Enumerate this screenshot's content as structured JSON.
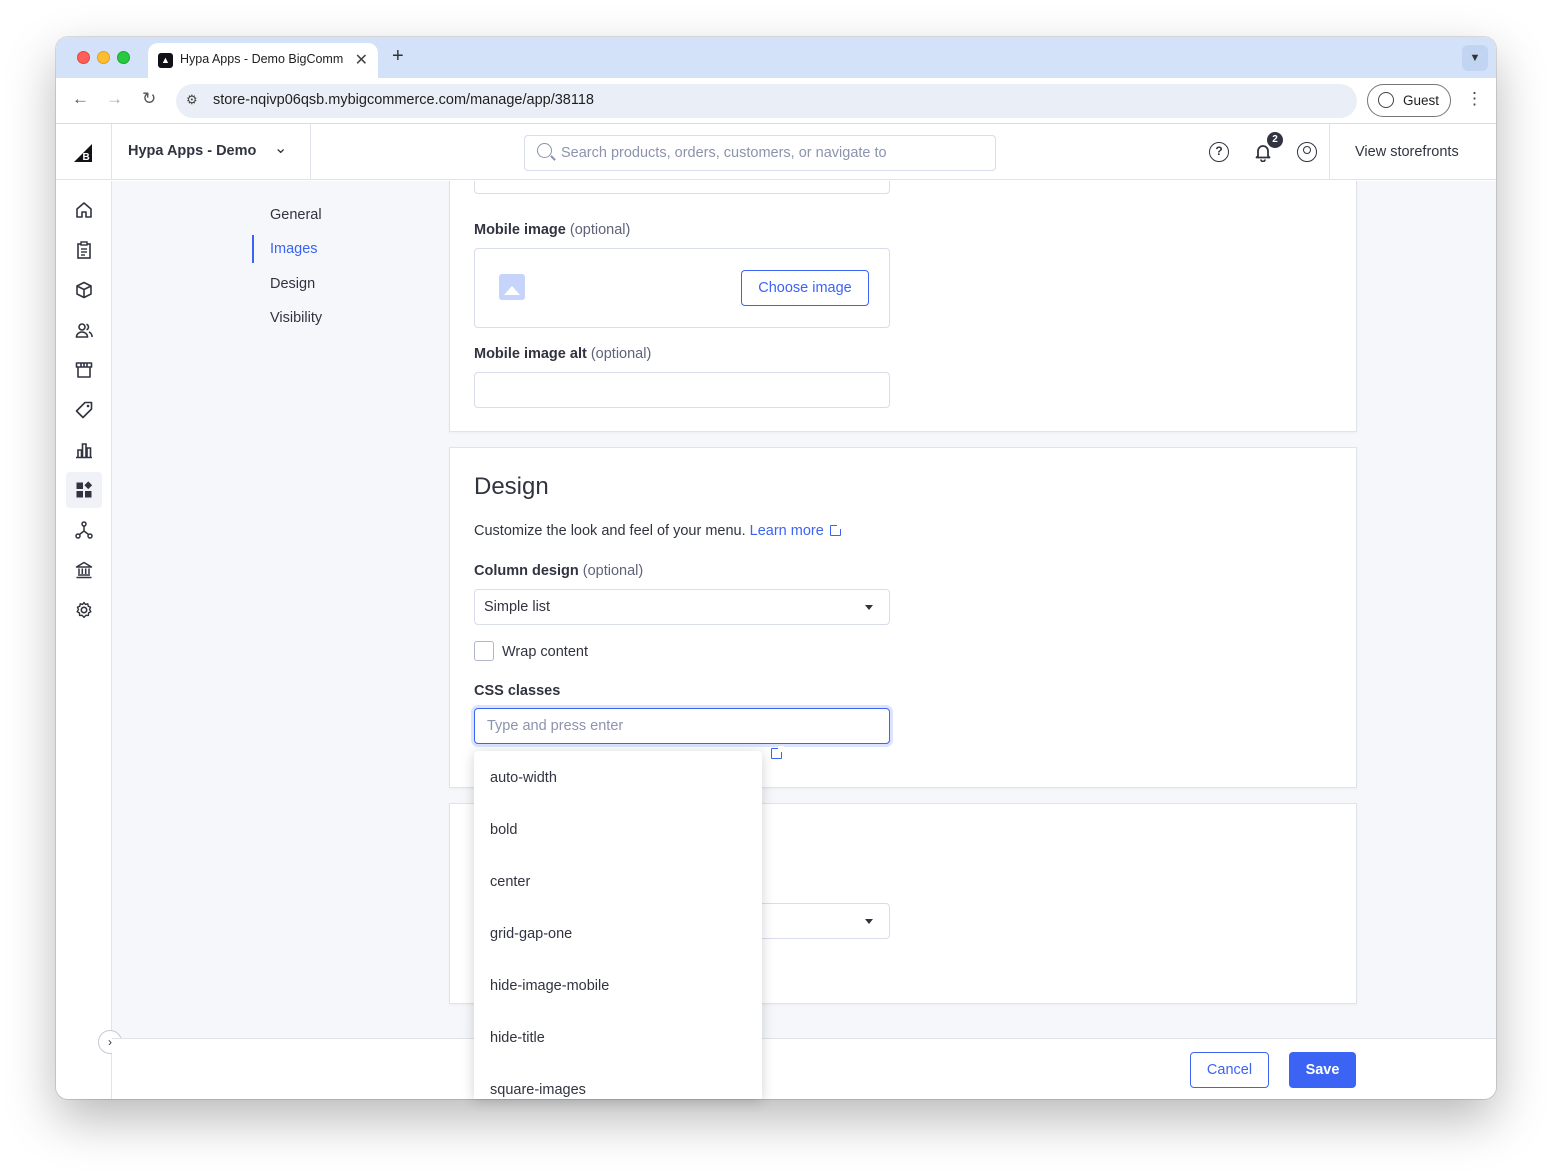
{
  "browser": {
    "tab_title": "Hypa Apps - Demo BigComm",
    "tab_close": "✕",
    "new_tab": "+",
    "url": "store-nqivp06qsb.mybigcommerce.com/manage/app/38118",
    "profile_label": "Guest"
  },
  "header": {
    "store_name": "Hypa Apps - Demo",
    "search_placeholder": "Search products, orders, customers, or navigate to",
    "notification_count": "2",
    "view_storefronts": "View storefronts"
  },
  "side_nav": {
    "icons": [
      "home-icon",
      "orders-icon",
      "products-icon",
      "customers-icon",
      "storefront-icon",
      "marketing-icon",
      "analytics-icon",
      "apps-icon",
      "channels-icon",
      "finance-icon",
      "settings-icon"
    ],
    "active": "apps-icon"
  },
  "sub_nav": {
    "items": [
      "General",
      "Images",
      "Design",
      "Visibility"
    ],
    "active": "Images"
  },
  "images_section": {
    "mobile_image_label": "Mobile image",
    "optional": "(optional)",
    "choose_image": "Choose image",
    "mobile_image_alt_label": "Mobile image alt",
    "mobile_image_alt_value": ""
  },
  "design_section": {
    "title": "Design",
    "description": "Customize the look and feel of your menu.",
    "learn_more": "Learn more",
    "column_design_label": "Column design",
    "column_design_value": "Simple list",
    "wrap_content_label": "Wrap content",
    "wrap_content_checked": false,
    "css_classes_label": "CSS classes",
    "css_classes_placeholder": "Type and press enter"
  },
  "css_dropdown": {
    "options": [
      "auto-width",
      "bold",
      "center",
      "grid-gap-one",
      "hide-image-mobile",
      "hide-title",
      "square-images"
    ]
  },
  "footer": {
    "cancel": "Cancel",
    "save": "Save"
  },
  "colors": {
    "accent": "#3c64f4",
    "text": "#313440",
    "background": "#f5f7fa"
  }
}
